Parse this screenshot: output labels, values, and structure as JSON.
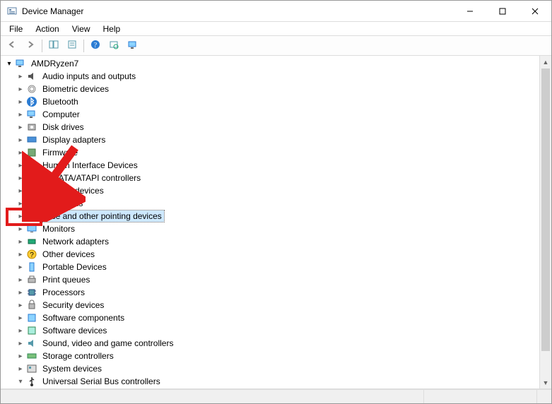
{
  "window": {
    "title": "Device Manager"
  },
  "menu": {
    "items": [
      "File",
      "Action",
      "View",
      "Help"
    ]
  },
  "toolbar": {
    "buttons": [
      {
        "name": "back-button",
        "icon": "arrow-left-icon"
      },
      {
        "name": "forward-button",
        "icon": "arrow-right-icon"
      },
      {
        "name": "show-hide-console-button",
        "icon": "console-tree-icon"
      },
      {
        "name": "properties-button",
        "icon": "properties-icon"
      },
      {
        "name": "help-button",
        "icon": "help-icon"
      },
      {
        "name": "scan-button",
        "icon": "scan-hardware-icon"
      },
      {
        "name": "show-hidden-button",
        "icon": "monitor-icon"
      }
    ]
  },
  "tree": {
    "root": "AMDRyzen7",
    "categories": [
      {
        "label": "Audio inputs and outputs",
        "icon": "audio-icon"
      },
      {
        "label": "Biometric devices",
        "icon": "fingerprint-icon"
      },
      {
        "label": "Bluetooth",
        "icon": "bluetooth-icon"
      },
      {
        "label": "Computer",
        "icon": "computer-icon"
      },
      {
        "label": "Disk drives",
        "icon": "disk-icon"
      },
      {
        "label": "Display adapters",
        "icon": "display-adapter-icon"
      },
      {
        "label": "Firmware",
        "icon": "firmware-icon"
      },
      {
        "label": "Human Interface Devices",
        "icon": "hid-icon"
      },
      {
        "label": "IDE ATA/ATAPI controllers",
        "icon": "ide-icon"
      },
      {
        "label": "Imaging devices",
        "icon": "imaging-icon"
      },
      {
        "label": "Keyboards",
        "icon": "keyboard-icon"
      },
      {
        "label": "Mice and other pointing devices",
        "icon": "mouse-icon",
        "selected": true
      },
      {
        "label": "Monitors",
        "icon": "monitor-device-icon"
      },
      {
        "label": "Network adapters",
        "icon": "network-icon"
      },
      {
        "label": "Other devices",
        "icon": "unknown-icon"
      },
      {
        "label": "Portable Devices",
        "icon": "portable-icon"
      },
      {
        "label": "Print queues",
        "icon": "printer-icon"
      },
      {
        "label": "Processors",
        "icon": "processor-icon"
      },
      {
        "label": "Security devices",
        "icon": "security-icon"
      },
      {
        "label": "Software components",
        "icon": "software-comp-icon"
      },
      {
        "label": "Software devices",
        "icon": "software-dev-icon"
      },
      {
        "label": "Sound, video and game controllers",
        "icon": "sound-icon"
      },
      {
        "label": "Storage controllers",
        "icon": "storage-icon"
      },
      {
        "label": "System devices",
        "icon": "system-icon"
      },
      {
        "label": "Universal Serial Bus controllers",
        "icon": "usb-icon"
      }
    ]
  }
}
